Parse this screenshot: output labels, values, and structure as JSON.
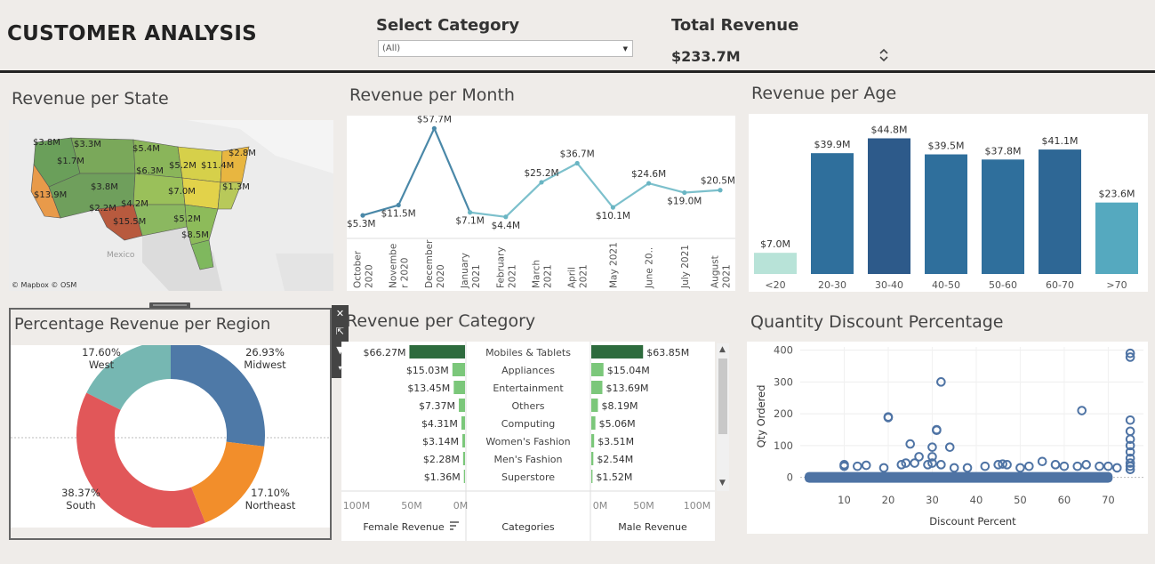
{
  "header": {
    "title": "CUSTOMER ANALYSIS",
    "category_label": "Select Category",
    "category_value": "(All)",
    "revenue_label": "Total Revenue",
    "revenue_value": "$233.7M"
  },
  "state_map": {
    "title": "Revenue per State",
    "attribution": "© Mapbox © OSM",
    "country_label": "Mexico",
    "labels": [
      "$3.8M",
      "$3.3M",
      "$1.7M",
      "$5.4M",
      "$6.3M",
      "$2.8M",
      "$5.2M",
      "$11.4M",
      "$3.8M",
      "$7.0M",
      "$1.3M",
      "$13.9M",
      "$2.2M",
      "$4.2M",
      "$15.5M",
      "$5.2M",
      "$8.5M"
    ]
  },
  "chart_data": [
    {
      "type": "line",
      "title": "Revenue per Month",
      "categories": [
        "October 2020",
        "November 2020",
        "December 2020",
        "January 2021",
        "February 2021",
        "March 2021",
        "April 2021",
        "May 2021",
        "June 2021",
        "July 2021",
        "August 2021"
      ],
      "tick_labels": [
        [
          "October",
          "2020"
        ],
        [
          "Novembe",
          "r 2020"
        ],
        [
          "December",
          "2020"
        ],
        [
          "January",
          "2021"
        ],
        [
          "February",
          "2021"
        ],
        [
          "March",
          "2021"
        ],
        [
          "April",
          "2021"
        ],
        [
          "May 2021"
        ],
        [
          "June 20.."
        ],
        [
          "July 2021"
        ],
        [
          "August",
          "2021"
        ]
      ],
      "values": [
        5.3,
        11.5,
        57.7,
        7.1,
        4.4,
        25.2,
        36.7,
        10.1,
        24.6,
        19.0,
        20.5
      ],
      "value_labels": [
        "$5.3M",
        "$11.5M",
        "$57.7M",
        "$7.1M",
        "$4.4M",
        "$25.2M",
        "$36.7M",
        "$10.1M",
        "$24.6M",
        "$19.0M",
        "$20.5M"
      ],
      "ylim": [
        0,
        60
      ]
    },
    {
      "type": "bar",
      "title": "Revenue per Age",
      "categories": [
        "<20",
        "20-30",
        "30-40",
        "40-50",
        "50-60",
        "60-70",
        ">70"
      ],
      "values": [
        7.0,
        39.9,
        44.8,
        39.5,
        37.8,
        41.1,
        23.6
      ],
      "value_labels": [
        "$7.0M",
        "$39.9M",
        "$44.8M",
        "$39.5M",
        "$37.8M",
        "$41.1M",
        "$23.6M"
      ],
      "colors": [
        "#b8e3d8",
        "#2f6f9c",
        "#2d5a8a",
        "#2f6f9c",
        "#2f6f9c",
        "#2e6795",
        "#55a9bf"
      ],
      "ylim": [
        0,
        47
      ]
    },
    {
      "type": "pie",
      "title": "Percentage Revenue  per Region",
      "slices": [
        {
          "name": "Midwest",
          "value": 26.93,
          "label": "26.93%",
          "color": "#4e79a7"
        },
        {
          "name": "Northeast",
          "value": 17.1,
          "label": "17.10%",
          "color": "#f28e2b"
        },
        {
          "name": "South",
          "value": 38.37,
          "label": "38.37%",
          "color": "#e15759"
        },
        {
          "name": "West",
          "value": 17.6,
          "label": "17.60%",
          "color": "#76b7b2"
        }
      ]
    },
    {
      "type": "bar",
      "title": "Revenue per Category",
      "categories": [
        "Mobiles & Tablets",
        "Appliances",
        "Entertainment",
        "Others",
        "Computing",
        "Women's Fashion",
        "Men's Fashion",
        "Superstore"
      ],
      "series": [
        {
          "name": "Female Revenue",
          "values": [
            66.27,
            15.03,
            13.45,
            7.37,
            4.31,
            3.14,
            2.28,
            1.36
          ],
          "labels": [
            "$66.27M",
            "$15.03M",
            "$13.45M",
            "$7.37M",
            "$4.31M",
            "$3.14M",
            "$2.28M",
            "$1.36M"
          ]
        },
        {
          "name": "Male Revenue",
          "values": [
            63.85,
            15.04,
            13.69,
            8.19,
            5.06,
            3.51,
            2.54,
            1.52
          ],
          "labels": [
            "$63.85M",
            "$15.04M",
            "$13.69M",
            "$8.19M",
            "$5.06M",
            "$3.51M",
            "$2.54M",
            "$1.52M"
          ]
        }
      ],
      "female_axis": [
        "100M",
        "50M",
        "0M"
      ],
      "male_axis": [
        "0M",
        "50M",
        "100M"
      ],
      "column_headers": [
        "Female Revenue",
        "Categories",
        "Male Revenue"
      ],
      "xlim": [
        0,
        100
      ]
    },
    {
      "type": "scatter",
      "title": "Quantity Discount Percentage",
      "xlabel": "Discount Percent",
      "ylabel": "Qty Ordered",
      "xticks": [
        10,
        20,
        30,
        40,
        50,
        60,
        70
      ],
      "yticks": [
        0,
        100,
        200,
        300,
        400
      ],
      "xlim": [
        0,
        78
      ],
      "ylim": [
        -15,
        410
      ],
      "points": [
        [
          10,
          35
        ],
        [
          10,
          40
        ],
        [
          13,
          35
        ],
        [
          15,
          38
        ],
        [
          19,
          30
        ],
        [
          20,
          190
        ],
        [
          20,
          188
        ],
        [
          23,
          40
        ],
        [
          24,
          45
        ],
        [
          25,
          105
        ],
        [
          26,
          45
        ],
        [
          27,
          65
        ],
        [
          29,
          40
        ],
        [
          30,
          95
        ],
        [
          30,
          65
        ],
        [
          30,
          45
        ],
        [
          31,
          150
        ],
        [
          31,
          148
        ],
        [
          32,
          300
        ],
        [
          32,
          40
        ],
        [
          34,
          95
        ],
        [
          35,
          30
        ],
        [
          38,
          30
        ],
        [
          42,
          35
        ],
        [
          45,
          40
        ],
        [
          46,
          42
        ],
        [
          47,
          40
        ],
        [
          50,
          30
        ],
        [
          52,
          35
        ],
        [
          55,
          50
        ],
        [
          58,
          40
        ],
        [
          60,
          35
        ],
        [
          63,
          35
        ],
        [
          64,
          210
        ],
        [
          65,
          40
        ],
        [
          68,
          35
        ],
        [
          70,
          35
        ],
        [
          72,
          30
        ],
        [
          75,
          390
        ],
        [
          75,
          378
        ],
        [
          75,
          180
        ],
        [
          75,
          145
        ],
        [
          75,
          120
        ],
        [
          75,
          100
        ],
        [
          75,
          80
        ],
        [
          75,
          60
        ],
        [
          75,
          45
        ],
        [
          75,
          35
        ],
        [
          75,
          25
        ]
      ],
      "band": {
        "x_from": 1,
        "x_to": 71,
        "y": 0
      }
    }
  ]
}
